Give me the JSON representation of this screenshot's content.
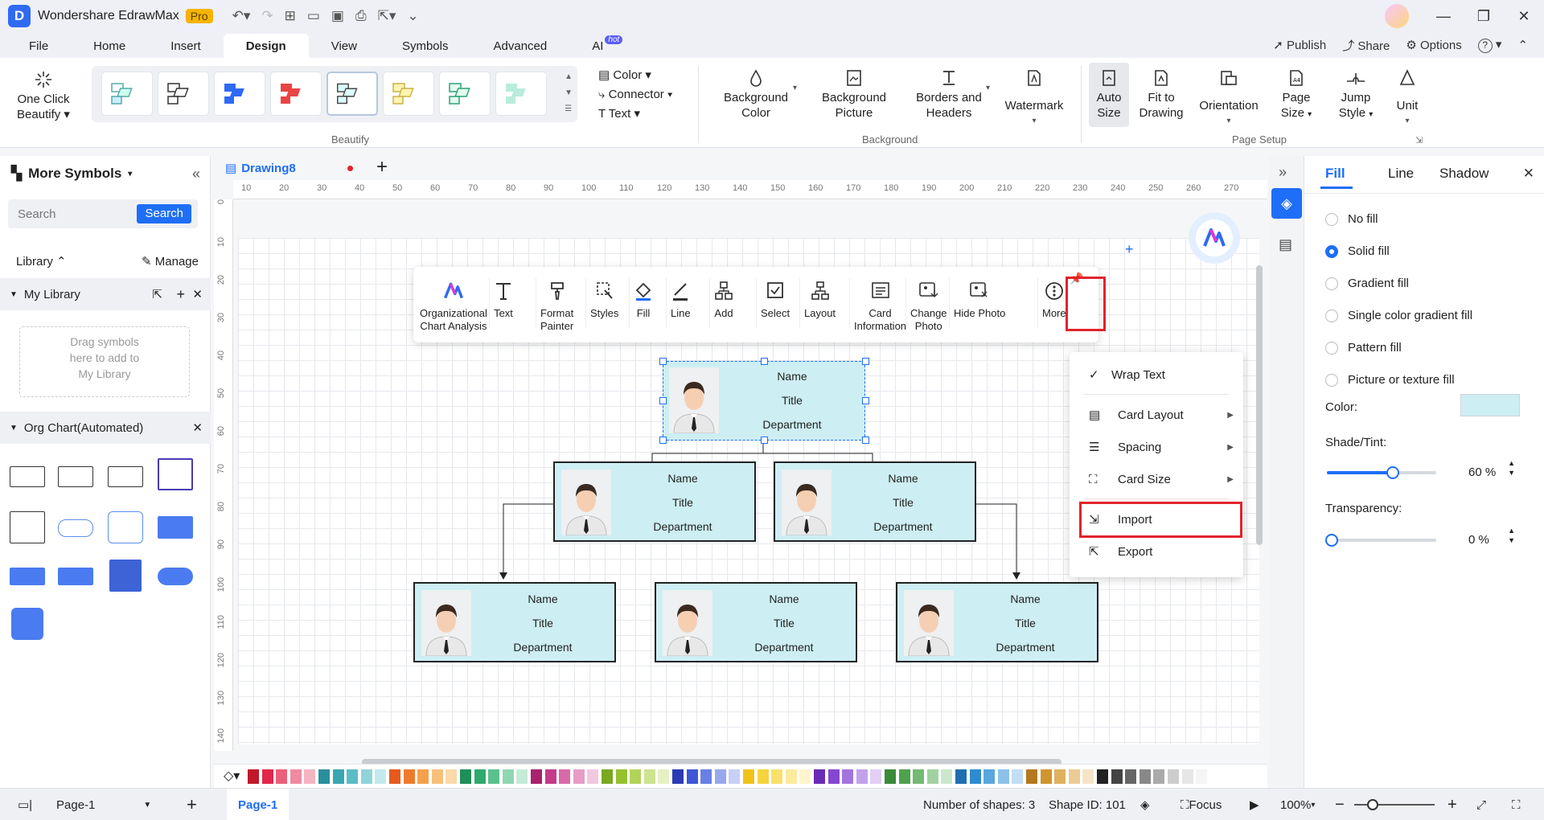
{
  "app": {
    "name": "Wondershare EdrawMax",
    "badge": "Pro"
  },
  "menu": {
    "tabs": [
      "File",
      "Home",
      "Insert",
      "Design",
      "View",
      "Symbols",
      "Advanced",
      "AI"
    ],
    "active": "Design",
    "ai_badge": "hot",
    "right": {
      "publish": "Publish",
      "share": "Share",
      "options": "Options",
      "help": "?"
    }
  },
  "ribbon": {
    "beautify_btn": [
      "One Click",
      "Beautify"
    ],
    "theme_small": {
      "color": "Color",
      "connector": "Connector",
      "text": "Text"
    },
    "background": {
      "bg_color": [
        "Background",
        "Color"
      ],
      "bg_picture": [
        "Background",
        "Picture"
      ],
      "borders": [
        "Borders and",
        "Headers"
      ],
      "watermark": "Watermark"
    },
    "page_setup": {
      "auto_size": [
        "Auto",
        "Size"
      ],
      "fit": [
        "Fit to",
        "Drawing"
      ],
      "orientation": "Orientation",
      "page_size": [
        "Page",
        "Size"
      ],
      "jump_style": [
        "Jump",
        "Style"
      ],
      "unit": "Unit"
    },
    "groups": {
      "beautify": "Beautify",
      "background": "Background",
      "page_setup": "Page Setup"
    }
  },
  "left_panel": {
    "title": "More Symbols",
    "search_placeholder": "Search",
    "search_btn": "Search",
    "library": "Library",
    "manage": "Manage",
    "my_library": "My Library",
    "drop_hint": [
      "Drag symbols",
      "here to add to",
      "My Library"
    ],
    "org_chart": "Org Chart(Automated)"
  },
  "doc_tab": {
    "name": "Drawing8"
  },
  "ruler_top": [
    "10",
    "20",
    "30",
    "40",
    "50",
    "60",
    "70",
    "80",
    "90",
    "100",
    "110",
    "120",
    "130",
    "140",
    "150",
    "160",
    "170",
    "180",
    "190",
    "200",
    "210",
    "220",
    "230",
    "240",
    "250",
    "260",
    "270"
  ],
  "ruler_left": [
    "0",
    "10",
    "20",
    "30",
    "40",
    "50",
    "60",
    "70",
    "80",
    "90",
    "100",
    "110",
    "120",
    "130",
    "140"
  ],
  "float_toolbar": [
    {
      "label": "Organizational\nChart Analysis",
      "icon": "org-analysis-icon"
    },
    {
      "label": "Text",
      "icon": "text-icon"
    },
    {
      "label": "Format\nPainter",
      "icon": "format-painter-icon"
    },
    {
      "label": "Styles",
      "icon": "styles-icon"
    },
    {
      "label": "Fill",
      "icon": "fill-icon"
    },
    {
      "label": "Line",
      "icon": "line-icon"
    },
    {
      "label": "Add",
      "icon": "add-icon"
    },
    {
      "label": "Select",
      "icon": "select-icon"
    },
    {
      "label": "Layout",
      "icon": "layout-icon"
    },
    {
      "label": "Card\nInformation",
      "icon": "card-info-icon"
    },
    {
      "label": "Change\nPhoto",
      "icon": "change-photo-icon"
    },
    {
      "label": "Hide Photo",
      "icon": "hide-photo-icon"
    },
    {
      "label": "More",
      "icon": "more-icon"
    }
  ],
  "card": {
    "name": "Name",
    "title": "Title",
    "department": "Department"
  },
  "context_menu": {
    "wrap": "Wrap Text",
    "card_layout": "Card Layout",
    "spacing": "Spacing",
    "card_size": "Card Size",
    "import": "Import",
    "export": "Export"
  },
  "right_panel": {
    "tabs": [
      "Fill",
      "Line",
      "Shadow"
    ],
    "options": [
      "No fill",
      "Solid fill",
      "Gradient fill",
      "Single color gradient fill",
      "Pattern fill",
      "Picture or texture fill"
    ],
    "selected": "Solid fill",
    "color_label": "Color:",
    "shade_label": "Shade/Tint:",
    "shade_value": "60 %",
    "shade_fraction": 0.6,
    "transparency_label": "Transparency:",
    "transparency_value": "0 %",
    "transparency_fraction": 0.0,
    "fill_color": "#cdeef3"
  },
  "status": {
    "page_tab": "Page-1",
    "page_name": "Page-1",
    "shapes": "Number of shapes: 3",
    "shape_id": "Shape ID: 101",
    "focus": "Focus",
    "zoom": "100%"
  },
  "colors": {
    "accent": "#1e6ef7",
    "highlight": "#e0242b",
    "card_fill": "#cdeef3"
  }
}
